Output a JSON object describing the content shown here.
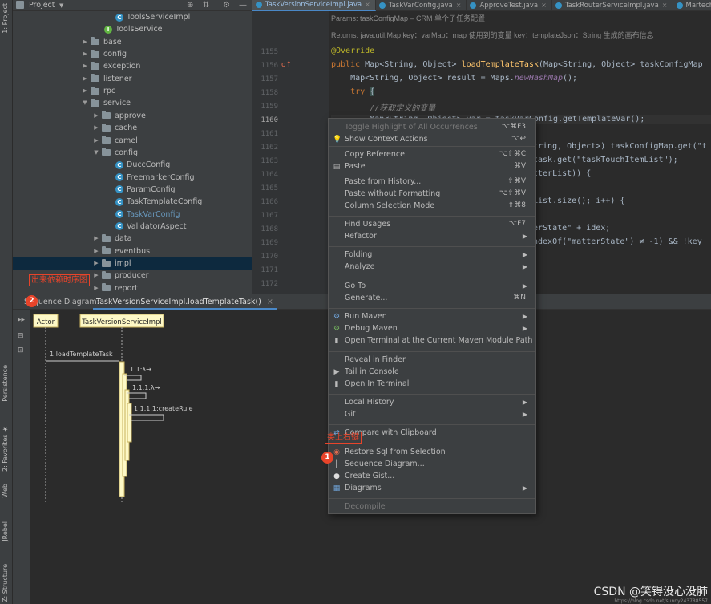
{
  "project_panel": {
    "title": "Project",
    "tree": [
      {
        "label": "ToolsServiceImpl",
        "kind": "class"
      },
      {
        "label": "ToolsService",
        "kind": "interface"
      },
      {
        "label": "base",
        "kind": "folder"
      },
      {
        "label": "config",
        "kind": "folder"
      },
      {
        "label": "exception",
        "kind": "folder"
      },
      {
        "label": "listener",
        "kind": "folder"
      },
      {
        "label": "rpc",
        "kind": "folder"
      },
      {
        "label": "service",
        "kind": "folder-open"
      },
      {
        "label": "approve",
        "kind": "folder"
      },
      {
        "label": "cache",
        "kind": "folder"
      },
      {
        "label": "camel",
        "kind": "folder"
      },
      {
        "label": "config",
        "kind": "folder-open"
      },
      {
        "label": "DuccConfig",
        "kind": "class"
      },
      {
        "label": "FreemarkerConfig",
        "kind": "class"
      },
      {
        "label": "ParamConfig",
        "kind": "class"
      },
      {
        "label": "TaskTemplateConfig",
        "kind": "class"
      },
      {
        "label": "TaskVarConfig",
        "kind": "class",
        "highlight": true
      },
      {
        "label": "ValidatorAspect",
        "kind": "class"
      },
      {
        "label": "data",
        "kind": "folder"
      },
      {
        "label": "eventbus",
        "kind": "folder"
      },
      {
        "label": "impl",
        "kind": "folder",
        "selected": true
      },
      {
        "label": "producer",
        "kind": "folder"
      },
      {
        "label": "report",
        "kind": "folder"
      }
    ]
  },
  "left_strip": {
    "project_tab": "1: Project",
    "persistence_tab": "Persistence",
    "favorites_tab": "2: Favorites",
    "web_tab": "Web",
    "jrebel_tab": "JRebel",
    "structure_tab": "Z: Structure"
  },
  "editor_tabs": [
    {
      "label": "TaskVersionServiceImpl.java",
      "active": true
    },
    {
      "label": "TaskVarConfig.java",
      "active": false
    },
    {
      "label": "ApproveTest.java",
      "active": false
    },
    {
      "label": "TaskRouterServiceImpl.java",
      "active": false
    },
    {
      "label": "MartechEx",
      "active": false
    }
  ],
  "editor": {
    "doc_lines": [
      "Params: taskConfigMap – CRM 单个子任务配置",
      "Returns: java.util.Map key：varMap：map 使用到的变量 key：templateJson：String 生成的画布信息"
    ],
    "line_numbers": [
      "1155",
      "1156",
      "1157",
      "1158",
      "1159",
      "1160",
      "1161",
      "1162",
      "1163",
      "1164",
      "1165",
      "1166",
      "1167",
      "1168",
      "1169",
      "1170",
      "1171",
      "1172"
    ],
    "annotation": "@Override",
    "comment": "//获取定义的变量",
    "partial_1160": "Map<String, Object> var = taskVarConfig.getTemplateVar();",
    "partial_1162": "tring, Object>) taskConfigMap.get(\"t",
    "partial_1163": "task.get(\"taskTouchItemList\");",
    "partial_1164": "tterList)) {",
    "partial_1166": "List.size(); i++) {",
    "partial_1168": "erState\" + idex;",
    "partial_1169": "ndexOf(\"matterState\") ≠ -1) && !key"
  },
  "sequence": {
    "panel_title": "Sequence Diagram:",
    "tab_label": "TaskVersionServiceImpl.loadTemplateTask()",
    "actor": "Actor",
    "target": "TaskVersionServiceImpl",
    "messages": [
      "1:loadTemplateTask",
      "1.1:λ→",
      "1.1.1:λ→",
      "1.1.1.1:createRule"
    ]
  },
  "context_menu": {
    "items": [
      {
        "label": "Toggle Highlight of All Occurrences",
        "shortcut": "⌥⌘F3",
        "dim": true
      },
      {
        "label": "Show Context Actions",
        "shortcut": "⌥↩",
        "icon": "bulb-icon"
      },
      {
        "label": "Copy Reference",
        "shortcut": "⌥⇧⌘C"
      },
      {
        "label": "Paste",
        "shortcut": "⌘V",
        "icon": "paste-icon"
      },
      {
        "label": "Paste from History...",
        "shortcut": "⇧⌘V"
      },
      {
        "label": "Paste without Formatting",
        "shortcut": "⌥⇧⌘V"
      },
      {
        "label": "Column Selection Mode",
        "shortcut": "⇧⌘8"
      },
      {
        "label": "Find Usages",
        "shortcut": "⌥F7"
      },
      {
        "label": "Refactor",
        "submenu": true
      },
      {
        "label": "Folding",
        "submenu": true
      },
      {
        "label": "Analyze",
        "submenu": true
      },
      {
        "label": "Go To",
        "submenu": true
      },
      {
        "label": "Generate...",
        "shortcut": "⌘N"
      },
      {
        "label": "Run Maven",
        "submenu": true,
        "icon": "maven-run-icon"
      },
      {
        "label": "Debug Maven",
        "submenu": true,
        "icon": "maven-debug-icon"
      },
      {
        "label": "Open Terminal at the Current Maven Module Path",
        "icon": "terminal-icon"
      },
      {
        "label": "Reveal in Finder"
      },
      {
        "label": "Tail in Console",
        "icon": "tail-icon"
      },
      {
        "label": "Open In Terminal",
        "icon": "terminal-icon"
      },
      {
        "label": "Local History",
        "submenu": true
      },
      {
        "label": "Git",
        "submenu": true
      },
      {
        "label": "Compare with Clipboard",
        "icon": "compare-icon"
      },
      {
        "label": "Restore Sql from Selection",
        "icon": "sql-icon"
      },
      {
        "label": "Sequence Diagram...",
        "icon": "sequence-icon"
      },
      {
        "label": "Create Gist...",
        "icon": "github-icon"
      },
      {
        "label": "Diagrams",
        "submenu": true,
        "icon": "diagrams-icon"
      },
      {
        "label": "Decompile",
        "dim": true
      }
    ]
  },
  "annotations": {
    "label_2": "出来依赖时序图",
    "badge_2": "2",
    "label_1": "类上右键",
    "badge_1": "1"
  },
  "watermark": {
    "main": "CSDN @笑锝没心没肺",
    "small": "https://blog.csdn.net/sunny243788557"
  },
  "colors": {
    "accent": "#4a88c7",
    "annotation_red": "#e8442a",
    "background": "#2b2b2b",
    "panel": "#3c3f41"
  }
}
